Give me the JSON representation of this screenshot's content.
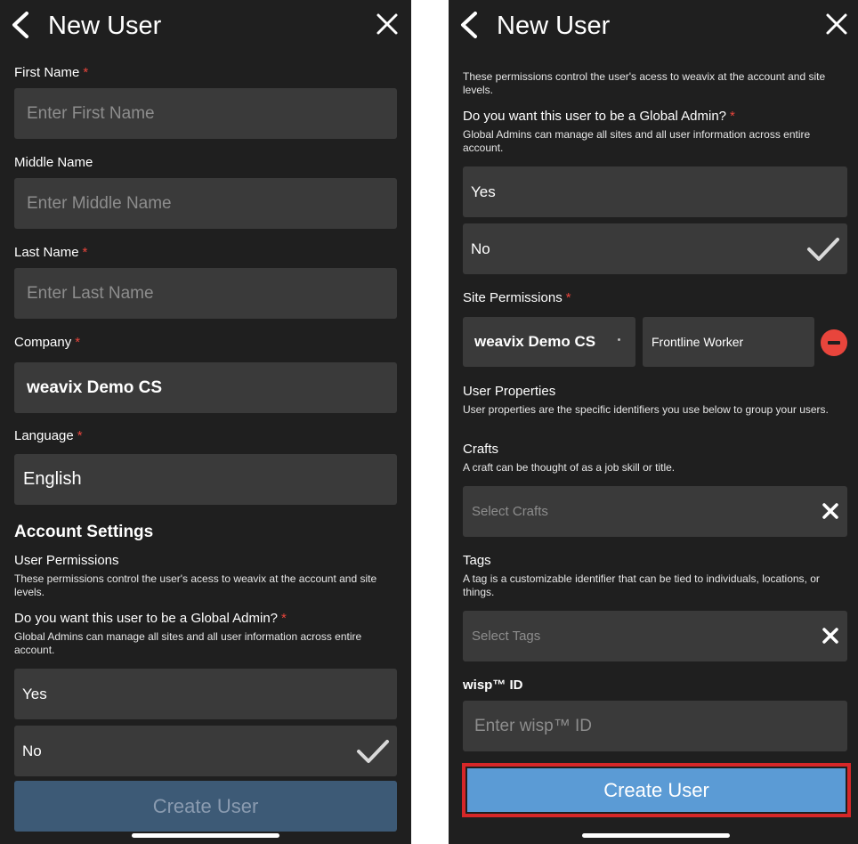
{
  "header": {
    "title": "New User"
  },
  "left": {
    "first_name": {
      "label": "First Name",
      "required": "*",
      "placeholder": "Enter First Name"
    },
    "middle_name": {
      "label": "Middle Name",
      "placeholder": "Enter Middle Name"
    },
    "last_name": {
      "label": "Last Name",
      "required": "*",
      "placeholder": "Enter Last Name"
    },
    "company": {
      "label": "Company",
      "required": "*",
      "value": "weavix Demo CS"
    },
    "language": {
      "label": "Language",
      "required": "*",
      "value": "English"
    },
    "account_settings": "Account Settings",
    "user_permissions": {
      "title": "User Permissions",
      "desc": "These permissions control the user's acess to weavix at the account and site levels."
    },
    "global_admin": {
      "question": "Do you want this user to be a Global Admin?",
      "required": "*",
      "desc": "Global Admins can manage all sites and all user information across entire account.",
      "options": [
        "Yes",
        "No"
      ],
      "selected": "No"
    },
    "create_button": "Create User"
  },
  "right": {
    "permissions_desc": "These permissions control the user's acess to weavix at the account and site levels.",
    "global_admin": {
      "question": "Do you want this user to be a Global Admin?",
      "required": "*",
      "desc": "Global Admins can manage all sites and all user information across entire account.",
      "options": [
        "Yes",
        "No"
      ],
      "selected": "No"
    },
    "site_permissions": {
      "label": "Site Permissions",
      "required": "*",
      "site": "weavix Demo CS",
      "role": "Frontline Worker"
    },
    "user_properties": {
      "title": "User Properties",
      "desc": "User properties are the specific identifiers you use below to group your users."
    },
    "crafts": {
      "label": "Crafts",
      "desc": "A craft can be thought of as a job skill or title.",
      "placeholder": "Select Crafts"
    },
    "tags": {
      "label": "Tags",
      "desc": "A tag is a customizable identifier that can be tied to individuals, locations, or things.",
      "placeholder": "Select Tags"
    },
    "wisp_id": {
      "label": "wisp™ ID",
      "placeholder": "Enter wisp™ ID"
    },
    "create_button": "Create User"
  },
  "colors": {
    "background": "#1f1f1f",
    "field": "#3a3a3a",
    "required": "#e8453c",
    "primary_button": "#5b9bd5",
    "disabled_button": "#3d5a76",
    "highlight": "#d62728"
  }
}
